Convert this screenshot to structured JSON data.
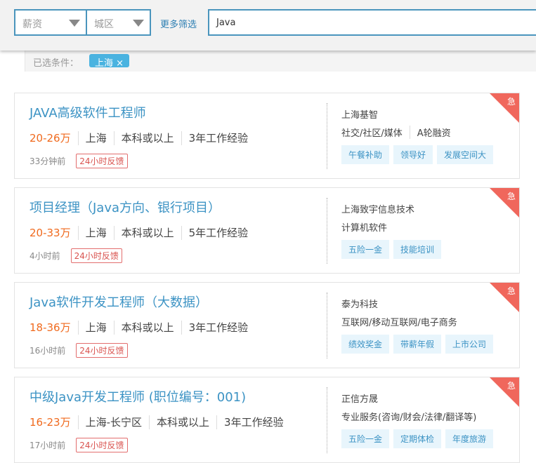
{
  "filters": {
    "salary": "薪资",
    "district": "城区",
    "more": "更多筛选",
    "search_value": "Java",
    "selected_label": "已选条件：",
    "selected_chip": "上海 ×"
  },
  "accent": "#3c93c4",
  "urgent_color": "#f0675c",
  "jobs": [
    {
      "title": "JAVA高级软件工程师",
      "salary": "20-26万",
      "city": "上海",
      "edu": "本科或以上",
      "exp": "3年工作经验",
      "time": "33分钟前",
      "feedback": "24小时反馈",
      "company": "上海基智",
      "industry": [
        "社交/社区/媒体",
        "A轮融资"
      ],
      "tags": [
        "午餐补助",
        "领导好",
        "发展空间大"
      ],
      "urgent": "急"
    },
    {
      "title": "项目经理（Java方向、银行项目）",
      "salary": "20-33万",
      "city": "上海",
      "edu": "本科或以上",
      "exp": "5年工作经验",
      "time": "4小时前",
      "feedback": "24小时反馈",
      "company": "上海致宇信息技术",
      "industry": [
        "计算机软件"
      ],
      "tags": [
        "五险一金",
        "技能培训"
      ],
      "urgent": "急"
    },
    {
      "title": "Java软件开发工程师（大数据）",
      "salary": "18-36万",
      "city": "上海",
      "edu": "本科或以上",
      "exp": "3年工作经验",
      "time": "16小时前",
      "feedback": "24小时反馈",
      "company": "泰为科技",
      "industry": [
        "互联网/移动互联网/电子商务"
      ],
      "tags": [
        "绩效奖金",
        "带薪年假",
        "上市公司"
      ],
      "urgent": "急"
    },
    {
      "title": "中级Java开发工程师 (职位编号：001)",
      "salary": "16-23万",
      "city": "上海-长宁区",
      "edu": "本科或以上",
      "exp": "3年工作经验",
      "time": "17小时前",
      "feedback": "24小时反馈",
      "company": "正信方晟",
      "industry": [
        "专业服务(咨询/财会/法律/翻译等)"
      ],
      "tags": [
        "五险一金",
        "定期体检",
        "年度旅游"
      ],
      "urgent": "急"
    }
  ]
}
